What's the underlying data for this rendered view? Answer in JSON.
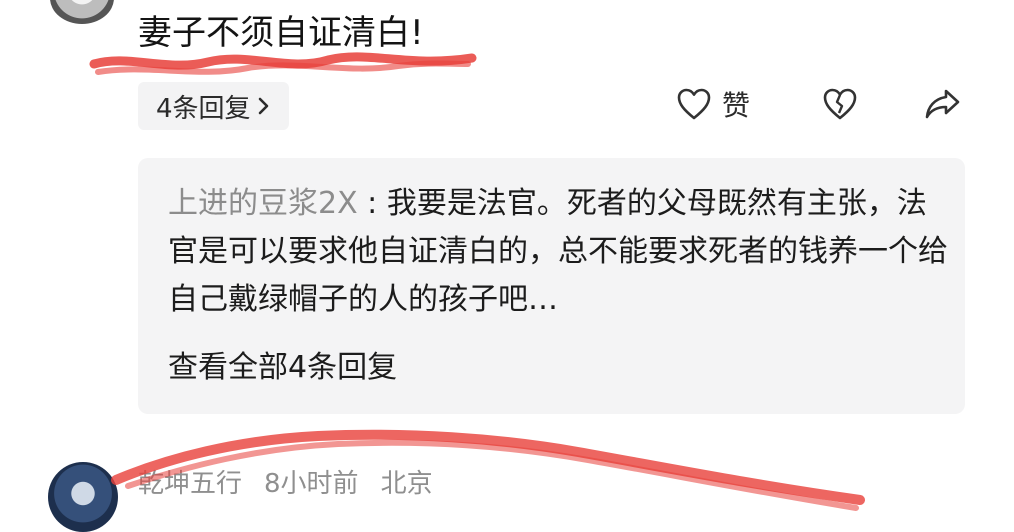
{
  "comment": {
    "text": "妻子不须自证清白!"
  },
  "replies_chip": {
    "label": "4条回复",
    "chevron_icon": "chevron-right-icon"
  },
  "actions": {
    "like_label": "赞",
    "like_icon": "heart-outline-icon",
    "dislike_icon": "broken-heart-icon",
    "share_icon": "share-arrow-icon"
  },
  "reply_preview": {
    "username": "上进的豆浆2X",
    "separator": " : ",
    "text": "我要是法官。死者的父母既然有主张，法官是可以要求他自证清白的，总不能要求死者的钱养一个给自己戴绿帽子的人的孩子吧…",
    "view_all_label": "查看全部4条回复"
  },
  "next_comment": {
    "username": "乾坤五行",
    "time": "8小时前",
    "location": "北京"
  },
  "colors": {
    "annotation_red": "#e8403a",
    "preview_bg": "#f4f4f5",
    "muted_text": "#8f8f8f"
  }
}
